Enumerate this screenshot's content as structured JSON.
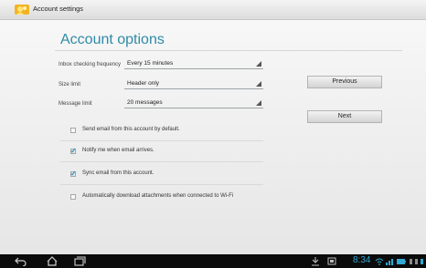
{
  "window": {
    "title": "Account settings"
  },
  "page": {
    "heading": "Account options"
  },
  "fields": [
    {
      "label": "Inbox checking frequency",
      "value": "Every 15 minutes"
    },
    {
      "label": "Size limit",
      "value": "Header only"
    },
    {
      "label": "Message limit",
      "value": "20 messages"
    }
  ],
  "buttons": {
    "previous": "Previous",
    "next": "Next"
  },
  "checkboxes": [
    {
      "label": "Send email from this account by default.",
      "checked": false
    },
    {
      "label": "Notify me when email arrives.",
      "checked": true
    },
    {
      "label": "Sync email from this account.",
      "checked": true
    },
    {
      "label": "Automatically download attachments when connected to Wi-Fi",
      "checked": false
    }
  ],
  "status_bar": {
    "time": "8:34"
  },
  "colors": {
    "accent": "#2e8ba7",
    "clock": "#30a9d5",
    "navbar": "#0b0b0b"
  },
  "icons": [
    "account-icon",
    "back-icon",
    "home-icon",
    "recent-apps-icon",
    "download-icon",
    "screenshot-icon",
    "wifi-icon",
    "signal-icon",
    "battery-icon"
  ]
}
